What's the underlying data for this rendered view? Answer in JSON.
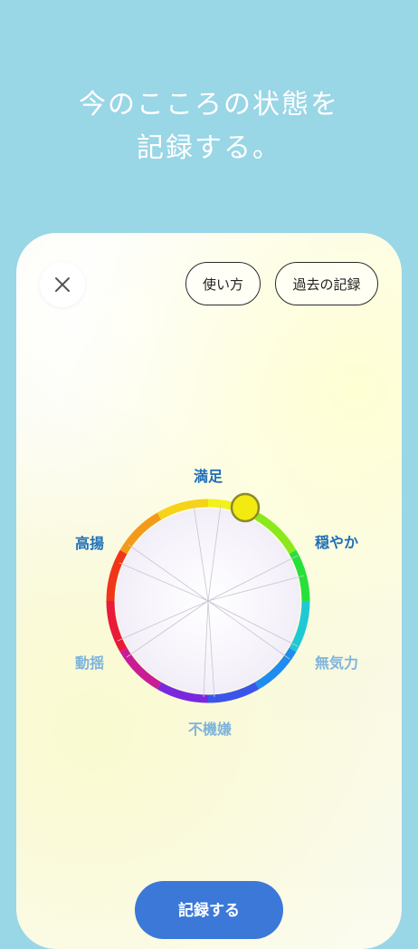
{
  "headline": {
    "line1": "今のこころの状態を",
    "line2": "記録する。"
  },
  "toolbar": {
    "usage_label": "使い方",
    "history_label": "過去の記録"
  },
  "wheel": {
    "labels": {
      "top": "満足",
      "top_right": "穏やか",
      "bottom_right": "無気力",
      "bottom": "不機嫌",
      "bottom_left": "動揺",
      "top_left": "高揚"
    },
    "selected_label": "満足",
    "handle_color": "#f2ea10"
  },
  "footer": {
    "record_label": "記録する"
  },
  "colors": {
    "background": "#99d6e6",
    "accent": "#3b78d8",
    "label_strong": "#1f6fb8",
    "label_light": "#7fb4dc"
  }
}
